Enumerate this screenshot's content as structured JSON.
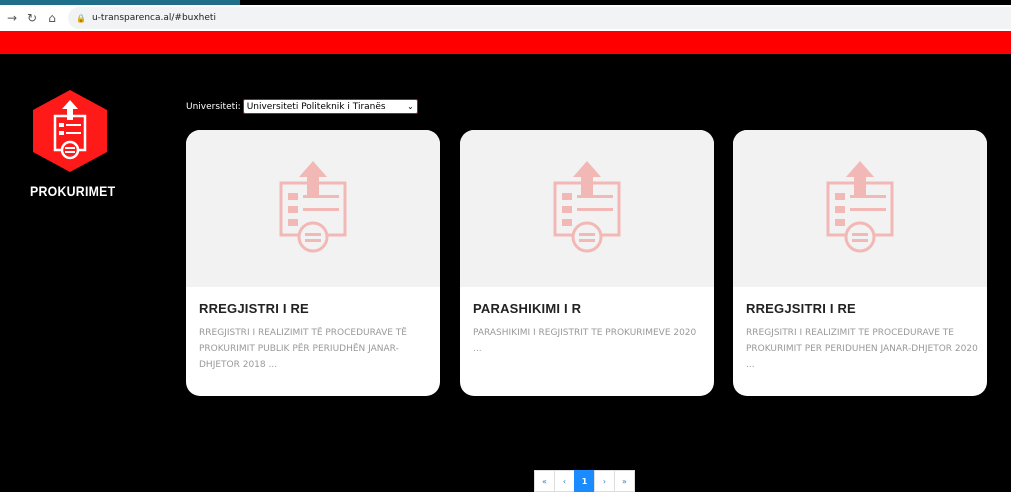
{
  "browser": {
    "url": "u-transparenca.al/#buxheti"
  },
  "logo": {
    "label": "PROKURIMET"
  },
  "filter": {
    "label": "Universiteti:",
    "selected": "Universiteti Politeknik i Tiranës"
  },
  "cards": [
    {
      "title": "RREGJISTRI I RE",
      "description": "RREGJISTRI I REALIZIMIT TË PROCEDURAVE TË PROKURIMIT PUBLIK PËR PERIUDHËN JANAR-DHJETOR 2018 ..."
    },
    {
      "title": "PARASHIKIMI I R",
      "description": "PARASHIKIMI I REGJISTRIT TE PROKURIMEVE 2020 ..."
    },
    {
      "title": "RREGJSITRI I RE",
      "description": "RREGJSITRI I REALIZIMIT TE PROCEDURAVE TE PROKURIMIT PER PERIDUHEN JANAR-DHJETOR 2020 ..."
    }
  ],
  "pagination": {
    "first": "«",
    "prev": "‹",
    "current": "1",
    "next": "›",
    "last": "»"
  },
  "colors": {
    "brand_red": "#ff0000",
    "icon_pink": "#f2b8b5",
    "active_page": "#1a8cff"
  }
}
